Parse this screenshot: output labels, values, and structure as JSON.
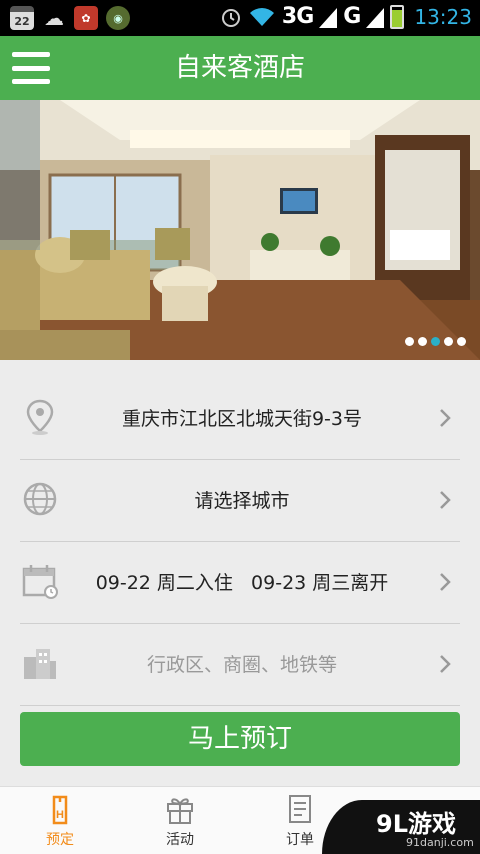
{
  "status_bar": {
    "calendar_day": "22",
    "network": "3G",
    "network2": "G",
    "time": "13:23",
    "battery_level": 0.85,
    "icons": [
      "calendar-icon",
      "cloud-icon",
      "app-notification-icon",
      "disc-icon",
      "alarm-icon",
      "wifi-icon",
      "signal-icon",
      "battery-icon"
    ]
  },
  "header": {
    "title": "自来客酒店",
    "menu_icon": "hamburger-menu-icon"
  },
  "banner": {
    "slide_count": 5,
    "active_slide": 3
  },
  "form": {
    "address": {
      "icon": "location-pin-icon",
      "value": "重庆市江北区北城天街9-3号"
    },
    "city": {
      "icon": "globe-icon",
      "value": "请选择城市"
    },
    "dates": {
      "icon": "calendar-icon",
      "value": "09-22 周二入住   09-23 周三离开"
    },
    "area": {
      "icon": "buildings-icon",
      "placeholder": "行政区、商圈、地铁等"
    }
  },
  "book_button": "马上预订",
  "bottom_nav": {
    "tabs": [
      {
        "label": "预定",
        "icon": "hotel-booking-icon",
        "active": true
      },
      {
        "label": "活动",
        "icon": "gift-icon",
        "active": false
      },
      {
        "label": "订单",
        "icon": "order-list-icon",
        "active": false
      }
    ]
  },
  "watermark": {
    "brand": "9L游戏",
    "url": "91danji.com"
  },
  "colors": {
    "primary": "#4caf50",
    "accent_active": "#f28c1a",
    "time": "#33b5e5",
    "dot_active": "#2ab0c8"
  }
}
